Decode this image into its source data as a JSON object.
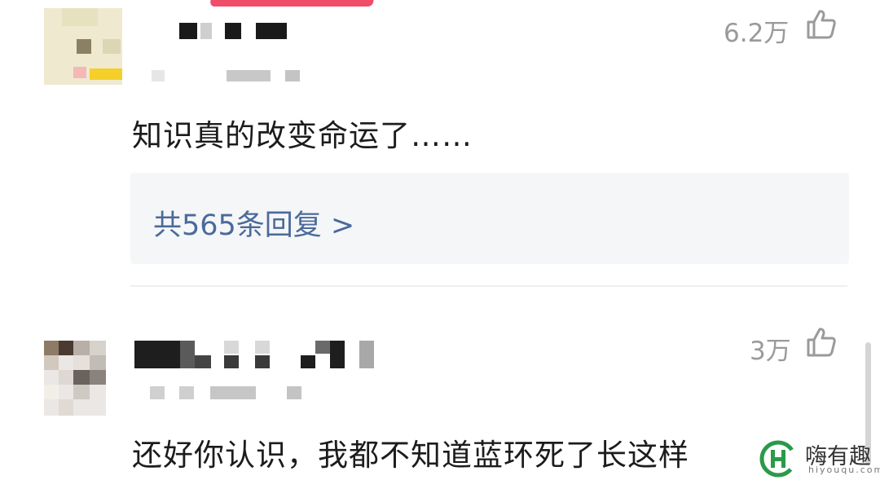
{
  "comments": [
    {
      "text": "知识真的改变命运了……",
      "likes": "6.2万",
      "reply_link": "共565条回复 >"
    },
    {
      "text": "还好你认识，我都不知道蓝环死了长这样",
      "likes": "3万"
    }
  ],
  "icons": {
    "like": "thumbs-up-outline-icon"
  },
  "watermark": {
    "brand": "嗨有趣",
    "url": "hiyouqu.com"
  },
  "colors": {
    "link": "#4a6a9a",
    "muted": "#9a9a9a",
    "reply_bg": "#f5f6f8"
  }
}
